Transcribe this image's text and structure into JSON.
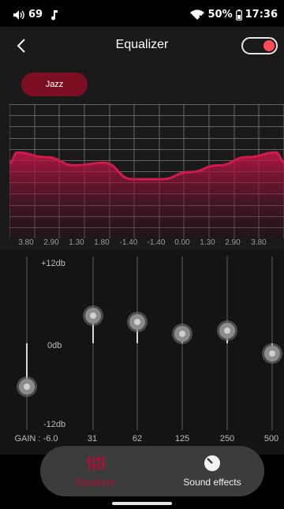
{
  "status_bar": {
    "volume_level": "69",
    "battery": "50%",
    "time": "17:36"
  },
  "header": {
    "title": "Equalizer",
    "toggle_on": true
  },
  "preset": {
    "label": "Jazz"
  },
  "graph": {
    "band_values": [
      "3.80",
      "2.90",
      "1.30",
      "1.80",
      "-1.40",
      "-1.40",
      "0.00",
      "1.30",
      "2.90",
      "3.80"
    ]
  },
  "sliders": {
    "max_label": "+12db",
    "mid_label": "0db",
    "min_label": "-12db",
    "gain_label": "GAIN : -6.0",
    "bands": [
      {
        "freq": "31",
        "value": 3.8
      },
      {
        "freq": "62",
        "value": 2.9
      },
      {
        "freq": "125",
        "value": 1.3
      },
      {
        "freq": "250",
        "value": 1.8
      },
      {
        "freq": "500",
        "value": -1.4
      }
    ],
    "gain_value": -6.0
  },
  "nav": {
    "equalizer_label": "Equalizer",
    "sound_effects_label": "Sound effects"
  },
  "colors": {
    "accent": "#b30e33",
    "preset_bg": "#7d0f24",
    "toggle_knob": "#ff4a55"
  }
}
